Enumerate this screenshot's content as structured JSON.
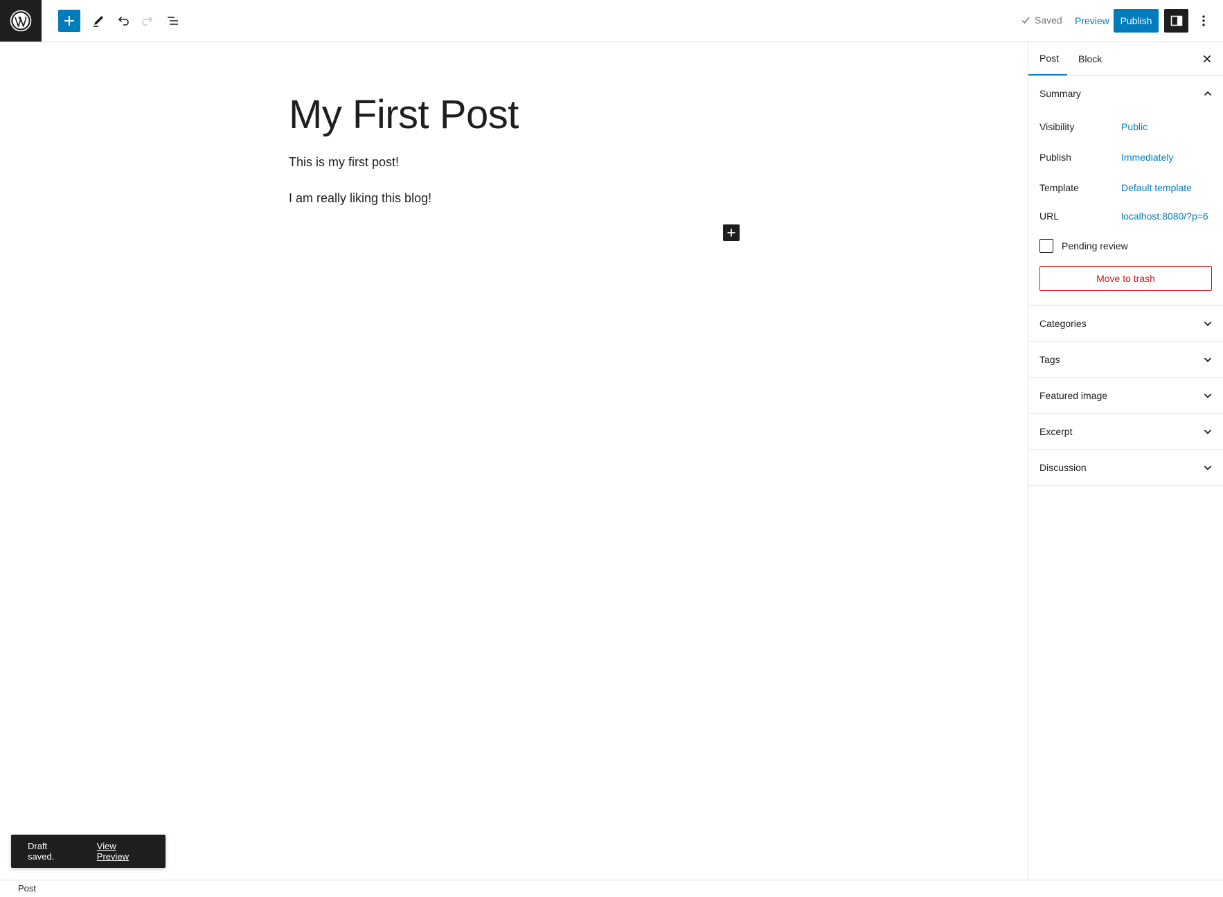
{
  "toolbar": {
    "logo_icon": "wordpress-logo-icon",
    "add_block_icon": "plus-icon",
    "tools_icon": "pencil-icon",
    "undo_icon": "undo-icon",
    "redo_icon": "redo-icon",
    "list_view_icon": "list-view-icon",
    "saved_label": "Saved",
    "preview_label": "Preview",
    "publish_label": "Publish",
    "settings_icon": "sidebar-toggle-icon",
    "options_icon": "more-vertical-icon"
  },
  "editor": {
    "title": "My First Post",
    "paragraphs": [
      "This is my first post!",
      "I am really liking this blog!"
    ]
  },
  "snackbar": {
    "message": "Draft saved.",
    "action": "View Preview"
  },
  "footer": {
    "breadcrumb": "Post"
  },
  "sidebar": {
    "tabs": [
      "Post",
      "Block"
    ],
    "active_tab": "Post",
    "summary": {
      "title": "Summary",
      "rows": [
        {
          "label": "Visibility",
          "value": "Public"
        },
        {
          "label": "Publish",
          "value": "Immediately"
        },
        {
          "label": "Template",
          "value": "Default template"
        },
        {
          "label": "URL",
          "value": "localhost:8080/?p=6"
        }
      ],
      "pending_review": "Pending review",
      "pending_checked": false,
      "trash_label": "Move to trash"
    },
    "panels": [
      "Categories",
      "Tags",
      "Featured image",
      "Excerpt",
      "Discussion"
    ]
  },
  "colors": {
    "accent": "#007cba",
    "dark": "#1e1e1e",
    "danger": "#cc1818",
    "border": "#e0e0e0"
  }
}
